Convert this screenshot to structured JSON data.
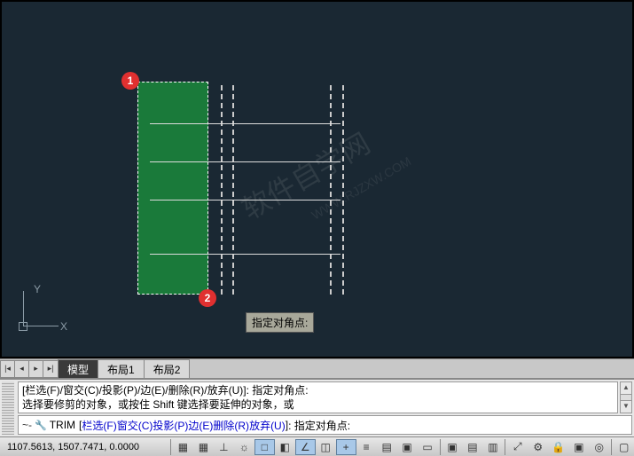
{
  "canvas": {
    "markers": {
      "m1": "1",
      "m2": "2"
    },
    "tooltip": "指定对角点:",
    "ucs": {
      "x": "X",
      "y": "Y"
    },
    "watermark": "软件自学网",
    "watermark_sub": "WWW.RJZXW.COM"
  },
  "tabs": {
    "active": "模型",
    "layout1": "布局1",
    "layout2": "布局2",
    "nav": {
      "first": "|◂",
      "prev": "◂",
      "next": "▸",
      "last": "▸|"
    }
  },
  "command": {
    "history_line1": "[栏选(F)/窗交(C)/投影(P)/边(E)/删除(R)/放弃(U)]: 指定对角点:",
    "history_line2": "选择要修剪的对象，或按住 Shift 键选择要延伸的对象，或",
    "input_prefix": "~-",
    "input_cmd": "TRIM",
    "input_bracket_open": "[",
    "opt_f": "栏选(F)",
    "opt_c": "窗交(C)",
    "opt_p": "投影(P)",
    "opt_e": "边(E)",
    "opt_r": "删除(R)",
    "opt_u": "放弃(U)",
    "input_bracket_close": "]",
    "input_suffix": ": 指定对角点:",
    "sep": " "
  },
  "status": {
    "coords": "1107.5613, 1507.7471, 0.0000"
  }
}
